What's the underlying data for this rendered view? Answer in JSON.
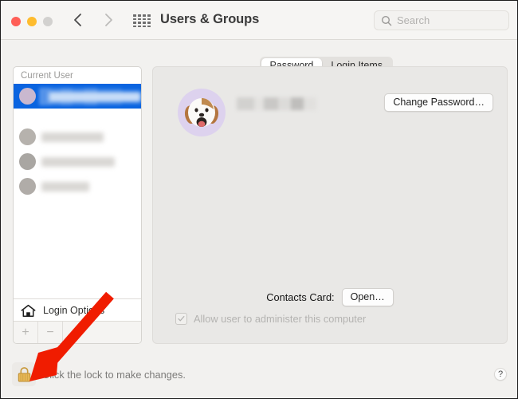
{
  "window": {
    "title": "Users & Groups",
    "traffic_lights": [
      "close",
      "minimize",
      "zoom-disabled"
    ],
    "back_label": "Back",
    "forward_label": "Forward",
    "grid_label": "Show All Preferences"
  },
  "search": {
    "placeholder": "Search",
    "value": "",
    "icon": "search-icon"
  },
  "sidebar": {
    "section_current_user": "Current User",
    "section_other_users": "",
    "current_user": {
      "name_redacted": true,
      "subtitle_redacted": true,
      "selected": true
    },
    "other_users": [
      {
        "name_redacted": true
      },
      {
        "name_redacted": true
      },
      {
        "name_redacted": true
      }
    ],
    "login_options": {
      "label": "Login Options",
      "icon": "home-icon"
    },
    "add_button": "+",
    "remove_button": "−"
  },
  "tabs": [
    {
      "label": "Password",
      "active": true
    },
    {
      "label": "Login Items",
      "active": false
    }
  ],
  "account": {
    "avatar_icon": "dog-memoji-avatar",
    "username_redacted": true,
    "change_password_label": "Change Password…",
    "contacts_card_label": "Contacts Card:",
    "contacts_open_label": "Open…",
    "admin_checkbox_label": "Allow user to administer this computer",
    "admin_checkbox_checked": true,
    "admin_checkbox_enabled": false
  },
  "footer": {
    "lock_icon": "closed-padlock-icon",
    "lock_message": "Click the lock to make changes.",
    "help_label": "?"
  },
  "annotation": {
    "arrow_color": "#f01c00",
    "arrow_target": "lock-button"
  },
  "colors": {
    "selection_blue": "#0a64e0",
    "window_chrome": "#f6f5f3",
    "panel_bg": "#e9e8e6",
    "avatar_bg": "#ddd2ee",
    "lock_gold": "#e2a93f"
  }
}
